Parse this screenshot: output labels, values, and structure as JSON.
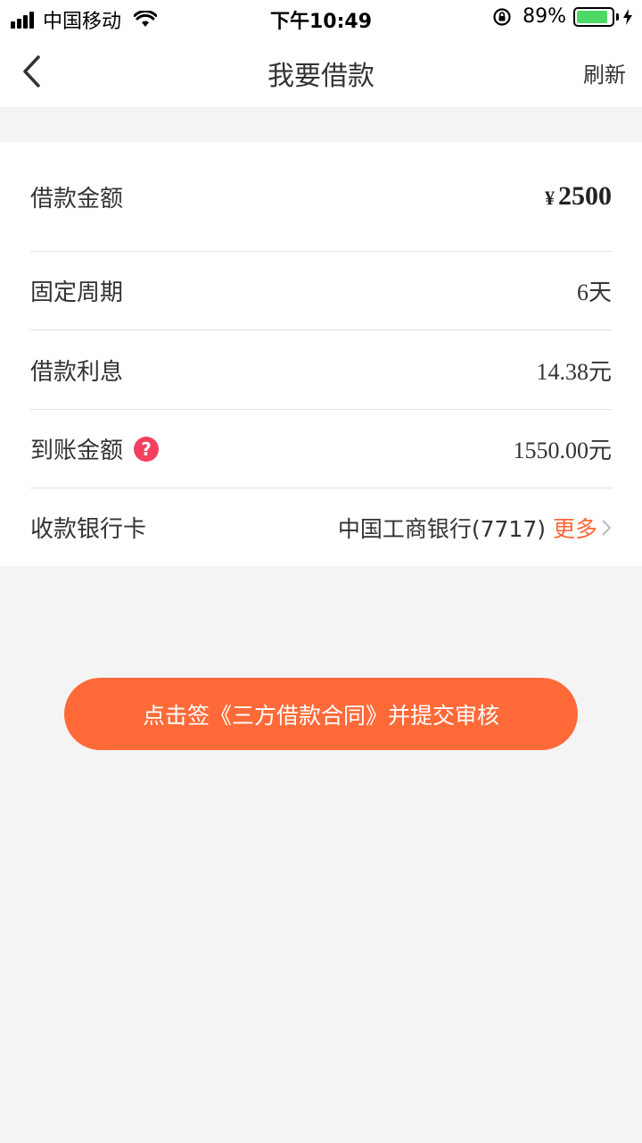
{
  "status_bar": {
    "carrier": "中国移动",
    "time": "下午10:49",
    "battery": "89%",
    "battery_level": 0.89
  },
  "nav": {
    "title": "我要借款",
    "refresh_label": "刷新"
  },
  "loan": {
    "amount_label": "借款金额",
    "currency_symbol": "¥",
    "amount_value": "2500",
    "period_label": "固定周期",
    "period_value": "6天",
    "interest_label": "借款利息",
    "interest_value": "14.38元",
    "received_label": "到账金额",
    "received_value": "1550.00元",
    "bank_label": "收款银行卡",
    "bank_value": "中国工商银行(7717)",
    "bank_more": "更多"
  },
  "submit": {
    "label": "点击签《三方借款合同》并提交审核"
  },
  "colors": {
    "accent": "#ff6a38",
    "help_icon": "#f43f5e",
    "background": "#f4f4f4"
  }
}
